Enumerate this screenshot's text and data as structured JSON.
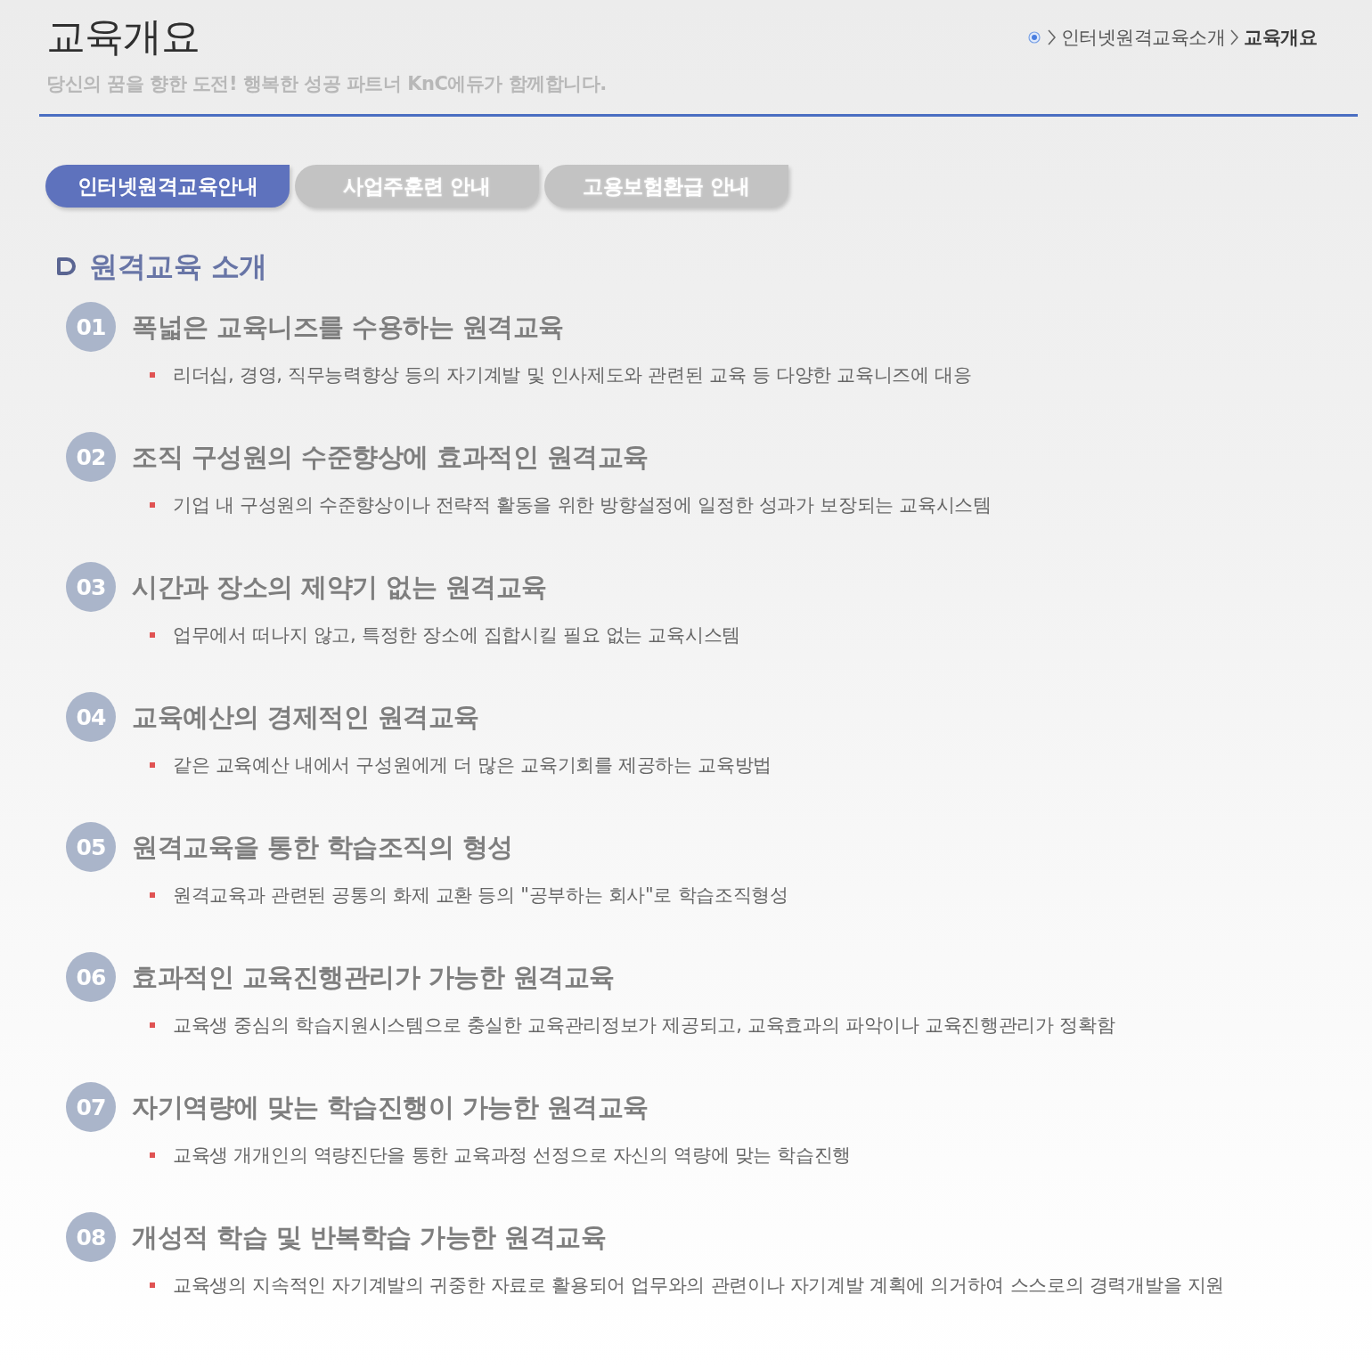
{
  "page_header": {
    "title": "교육개요",
    "subtitle": "당신의 꿈을 향한 도전! 행복한 성공 파트너 KnC에듀가 함께합니다."
  },
  "breadcrumb": [
    {
      "label": "인터넷원격교육소개",
      "current": false
    },
    {
      "label": "교육개요",
      "current": true
    }
  ],
  "tabs": [
    {
      "label": "인터넷원격교육안내",
      "selected": true
    },
    {
      "label": "사업주훈련 안내",
      "selected": false
    },
    {
      "label": "고용보험환급 안내",
      "selected": false
    }
  ],
  "section": {
    "title": "원격교육 소개"
  },
  "items": [
    {
      "number": "01",
      "title": "폭넓은 교육니즈를 수용하는 원격교육",
      "description": "리더십, 경영, 직무능력향상 등의 자기계발 및 인사제도와 관련된 교육 등 다양한 교육니즈에 대응"
    },
    {
      "number": "02",
      "title": "조직 구성원의 수준향상에 효과적인 원격교육",
      "description": "기업 내 구성원의 수준향상이나 전략적 활동을 위한 방향설정에 일정한 성과가 보장되는 교육시스템"
    },
    {
      "number": "03",
      "title": "시간과 장소의 제약기 없는 원격교육",
      "description": "업무에서 떠나지 않고, 특정한 장소에 집합시킬 필요 없는 교육시스템"
    },
    {
      "number": "04",
      "title": "교육예산의 경제적인 원격교육",
      "description": "같은 교육예산 내에서 구성원에게 더 많은 교육기회를 제공하는 교육방법"
    },
    {
      "number": "05",
      "title": "원격교육을 통한 학습조직의 형성",
      "description": "원격교육과 관련된 공통의 화제 교환 등의 \"공부하는 회사\"로 학습조직형성"
    },
    {
      "number": "06",
      "title": "효과적인 교육진행관리가 가능한 원격교육",
      "description": "교육생 중심의 학습지원시스템으로 충실한 교육관리정보가 제공되고, 교육효과의 파악이나 교육진행관리가 정확함"
    },
    {
      "number": "07",
      "title": "자기역량에 맞는 학습진행이 가능한 원격교육",
      "description": "교육생 개개인의 역량진단을 통한 교육과정 선정으로 자신의 역량에 맞는 학습진행"
    },
    {
      "number": "08",
      "title": "개성적 학습 및 반복학습 가능한 원격교육",
      "description": "교육생의 지속적인 자기계발의 귀중한 자료로 활용되어 업무와의 관련이나 자기계발 계획에 의거하여 스스로의 경력개발을 지원"
    }
  ]
}
